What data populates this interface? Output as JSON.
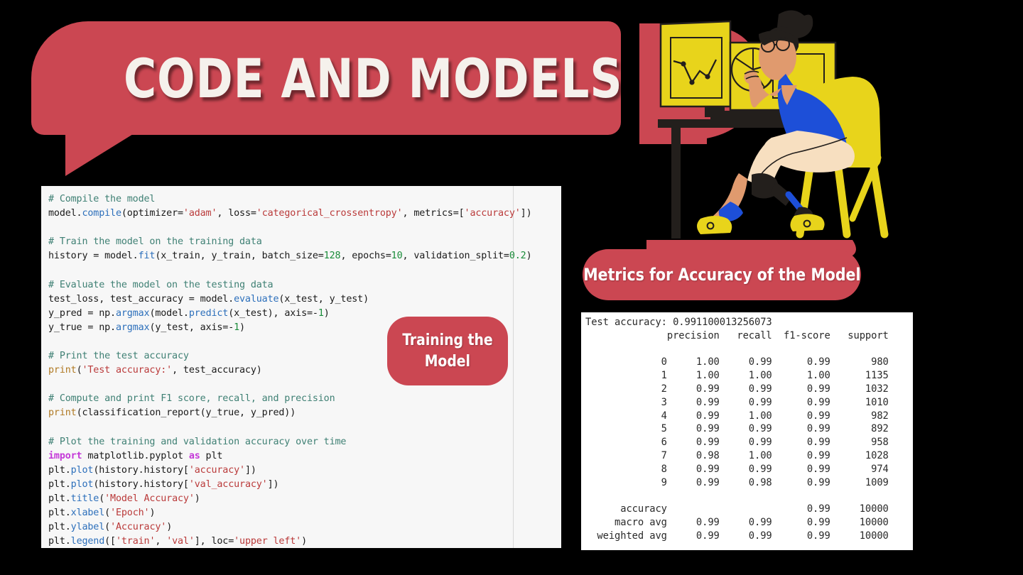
{
  "header": {
    "title": "CODE AND MODELS",
    "bubble_color": "#cb4752"
  },
  "badges": {
    "training": {
      "line1": "Training the",
      "line2": "Model"
    },
    "metrics": {
      "label": "Metrics for Accuracy of the Model"
    }
  },
  "code_panel": {
    "language": "python",
    "lines": [
      {
        "type": "comment",
        "text": "# Compile the model"
      },
      {
        "type": "code",
        "text": "model.compile(optimizer='adam', loss='categorical_crossentropy', metrics=['accuracy'])"
      },
      {
        "type": "blank",
        "text": ""
      },
      {
        "type": "comment",
        "text": "# Train the model on the training data"
      },
      {
        "type": "code",
        "text": "history = model.fit(x_train, y_train, batch_size=128, epochs=10, validation_split=0.2)"
      },
      {
        "type": "blank",
        "text": ""
      },
      {
        "type": "comment",
        "text": "# Evaluate the model on the testing data"
      },
      {
        "type": "code",
        "text": "test_loss, test_accuracy = model.evaluate(x_test, y_test)"
      },
      {
        "type": "code",
        "text": "y_pred = np.argmax(model.predict(x_test), axis=-1)"
      },
      {
        "type": "code",
        "text": "y_true = np.argmax(y_test, axis=-1)"
      },
      {
        "type": "blank",
        "text": ""
      },
      {
        "type": "comment",
        "text": "# Print the test accuracy"
      },
      {
        "type": "code",
        "text": "print('Test accuracy:', test_accuracy)"
      },
      {
        "type": "blank",
        "text": ""
      },
      {
        "type": "comment",
        "text": "# Compute and print F1 score, recall, and precision"
      },
      {
        "type": "code",
        "text": "print(classification_report(y_true, y_pred))"
      },
      {
        "type": "blank",
        "text": ""
      },
      {
        "type": "comment",
        "text": "# Plot the training and validation accuracy over time"
      },
      {
        "type": "code",
        "text": "import matplotlib.pyplot as plt"
      },
      {
        "type": "code",
        "text": "plt.plot(history.history['accuracy'])"
      },
      {
        "type": "code",
        "text": "plt.plot(history.history['val_accuracy'])"
      },
      {
        "type": "code",
        "text": "plt.title('Model Accuracy')"
      },
      {
        "type": "code",
        "text": "plt.xlabel('Epoch')"
      },
      {
        "type": "code",
        "text": "plt.ylabel('Accuracy')"
      },
      {
        "type": "code",
        "text": "plt.legend(['train', 'val'], loc='upper left')"
      }
    ]
  },
  "report_panel": {
    "test_accuracy_line": "Test accuracy: 0.991100013256073",
    "columns": [
      "",
      "precision",
      "recall",
      "f1-score",
      "support"
    ],
    "rows": [
      {
        "label": "0",
        "precision": "1.00",
        "recall": "0.99",
        "f1": "0.99",
        "support": "980"
      },
      {
        "label": "1",
        "precision": "1.00",
        "recall": "1.00",
        "f1": "1.00",
        "support": "1135"
      },
      {
        "label": "2",
        "precision": "0.99",
        "recall": "0.99",
        "f1": "0.99",
        "support": "1032"
      },
      {
        "label": "3",
        "precision": "0.99",
        "recall": "0.99",
        "f1": "0.99",
        "support": "1010"
      },
      {
        "label": "4",
        "precision": "0.99",
        "recall": "1.00",
        "f1": "0.99",
        "support": "982"
      },
      {
        "label": "5",
        "precision": "0.99",
        "recall": "0.99",
        "f1": "0.99",
        "support": "892"
      },
      {
        "label": "6",
        "precision": "0.99",
        "recall": "0.99",
        "f1": "0.99",
        "support": "958"
      },
      {
        "label": "7",
        "precision": "0.98",
        "recall": "1.00",
        "f1": "0.99",
        "support": "1028"
      },
      {
        "label": "8",
        "precision": "0.99",
        "recall": "0.99",
        "f1": "0.99",
        "support": "974"
      },
      {
        "label": "9",
        "precision": "0.99",
        "recall": "0.98",
        "f1": "0.99",
        "support": "1009"
      }
    ],
    "summary_rows": [
      {
        "label": "accuracy",
        "precision": "",
        "recall": "",
        "f1": "0.99",
        "support": "10000"
      },
      {
        "label": "macro avg",
        "precision": "0.99",
        "recall": "0.99",
        "f1": "0.99",
        "support": "10000"
      },
      {
        "label": "weighted avg",
        "precision": "0.99",
        "recall": "0.99",
        "f1": "0.99",
        "support": "10000"
      }
    ]
  },
  "illustration": {
    "name": "woman-at-desk-with-dual-monitors-illustration",
    "colors": {
      "yellow": "#e8d41b",
      "blue": "#1d4fd8",
      "red": "#cb4752",
      "dark": "#231f1c",
      "skin": "#e09a6e",
      "skin_light": "#f7dfc0"
    },
    "monitor_left_content": "line-chart",
    "monitor_right_content": "pie-chart"
  }
}
